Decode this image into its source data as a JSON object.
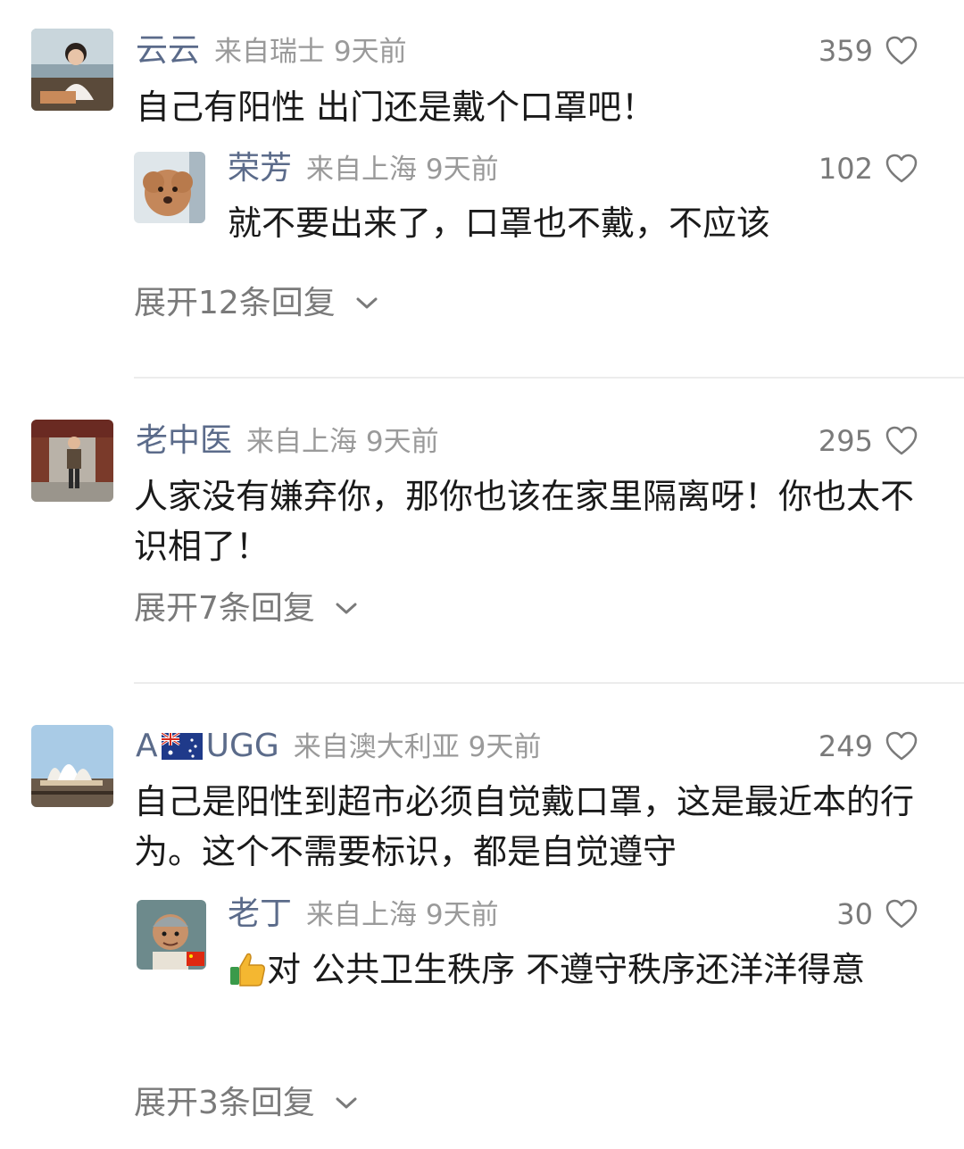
{
  "comments": [
    {
      "user": "云云",
      "meta": "来自瑞士 9天前",
      "likes": "359",
      "text": "自己有阳性 出门还是戴个口罩吧！",
      "avatar_icon": "woman-portrait-avatar",
      "reply": {
        "user": "荣芳",
        "meta": "来自上海 9天前",
        "likes": "102",
        "text": "就不要出来了，口罩也不戴，不应该",
        "avatar_icon": "poodle-dog-avatar"
      },
      "expand": "展开12条回复"
    },
    {
      "user": "老中医",
      "meta": "来自上海 9天前",
      "likes": "295",
      "text": "人家没有嫌弃你，那你也该在家里隔离呀！你也太不识相了！",
      "avatar_icon": "woman-standing-avatar",
      "expand": "展开7条回复"
    },
    {
      "user_prefix": "A",
      "user_suffix": "UGG",
      "flag_icon": "australia-flag-icon",
      "meta": "来自澳大利亚 9天前",
      "likes": "249",
      "text": "自己是阳性到超市必须自觉戴口罩，这是最近本的行为。这个不需要标识，都是自觉遵守",
      "avatar_icon": "sydney-opera-house-avatar",
      "reply": {
        "user": "老丁",
        "meta": "来自上海 9天前",
        "likes": "30",
        "text_icon": "thumbs-up-icon",
        "text": "对 公共卫生秩序  不遵守秩序还洋洋得意",
        "avatar_icon": "cartoon-man-avatar"
      },
      "expand": "展开3条回复"
    }
  ],
  "colors": {
    "name": "#5b6b8a",
    "meta": "#9a9a9a",
    "text": "#1a1a1a",
    "divider": "#ececec"
  }
}
